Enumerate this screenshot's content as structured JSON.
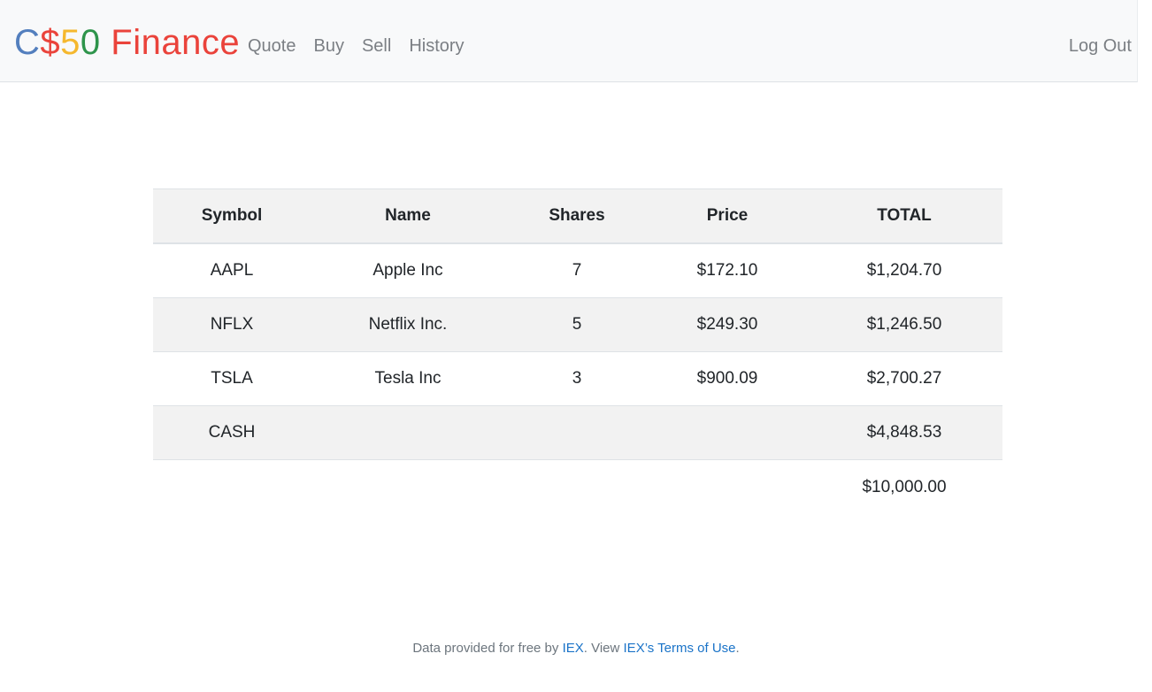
{
  "navbar": {
    "brand": {
      "part1": "C",
      "part2": "$",
      "part3": "5",
      "part4": "0",
      "part5": " Finance"
    },
    "links": [
      {
        "label": "Quote"
      },
      {
        "label": "Buy"
      },
      {
        "label": "Sell"
      },
      {
        "label": "History"
      }
    ],
    "logout_label": "Log Out"
  },
  "table": {
    "headers": [
      "Symbol",
      "Name",
      "Shares",
      "Price",
      "TOTAL"
    ],
    "rows": [
      {
        "symbol": "AAPL",
        "name": "Apple Inc",
        "shares": "7",
        "price": "$172.10",
        "total": "$1,204.70"
      },
      {
        "symbol": "NFLX",
        "name": "Netflix Inc.",
        "shares": "5",
        "price": "$249.30",
        "total": "$1,246.50"
      },
      {
        "symbol": "TSLA",
        "name": "Tesla Inc",
        "shares": "3",
        "price": "$900.09",
        "total": "$2,700.27"
      },
      {
        "symbol": "CASH",
        "name": "",
        "shares": "",
        "price": "",
        "total": "$4,848.53"
      }
    ],
    "grand_total": "$10,000.00"
  },
  "footer": {
    "text_before": "Data provided for free by ",
    "iex_link": "IEX",
    "text_middle": ". View ",
    "terms_link": "IEX’s Terms of Use",
    "text_after": "."
  },
  "colors": {
    "brand_blue": "#537fbe",
    "brand_red": "#ea433b",
    "brand_yellow": "#f5b82e",
    "brand_green": "#2e944b",
    "link": "#1a73c8"
  }
}
